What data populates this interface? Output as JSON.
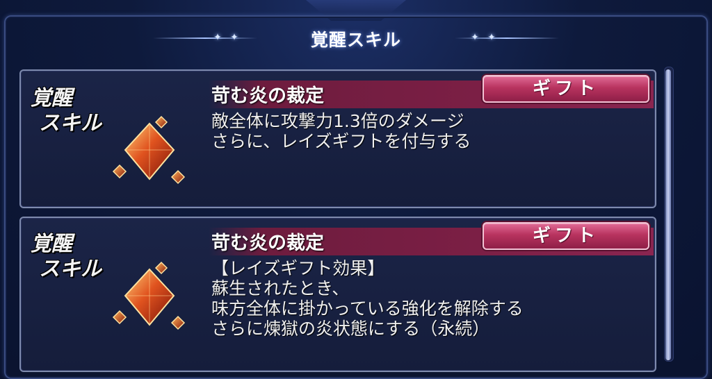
{
  "header": {
    "title": "覚醒スキル"
  },
  "skills": [
    {
      "side_label_line1": "覚醒",
      "side_label_line2": "スキル",
      "icon": "awakening-gem-icon",
      "name": "苛む炎の裁定",
      "tag": "ギフト",
      "description": [
        "敵全体に攻撃力1.3倍のダメージ",
        "さらに、レイズギフトを付与する"
      ]
    },
    {
      "side_label_line1": "覚醒",
      "side_label_line2": "スキル",
      "icon": "awakening-gem-icon",
      "name": "苛む炎の裁定",
      "tag": "ギフト",
      "description": [
        "【レイズギフト効果】",
        "蘇生されたとき、",
        "味方全体に掛かっている強化を解除する",
        "さらに煉獄の炎状態にする（永続）"
      ]
    }
  ],
  "colors": {
    "background": "#0b1430",
    "card": "#1b2447",
    "title_band": "#7b1f45",
    "tag_button": "#b8335f"
  }
}
